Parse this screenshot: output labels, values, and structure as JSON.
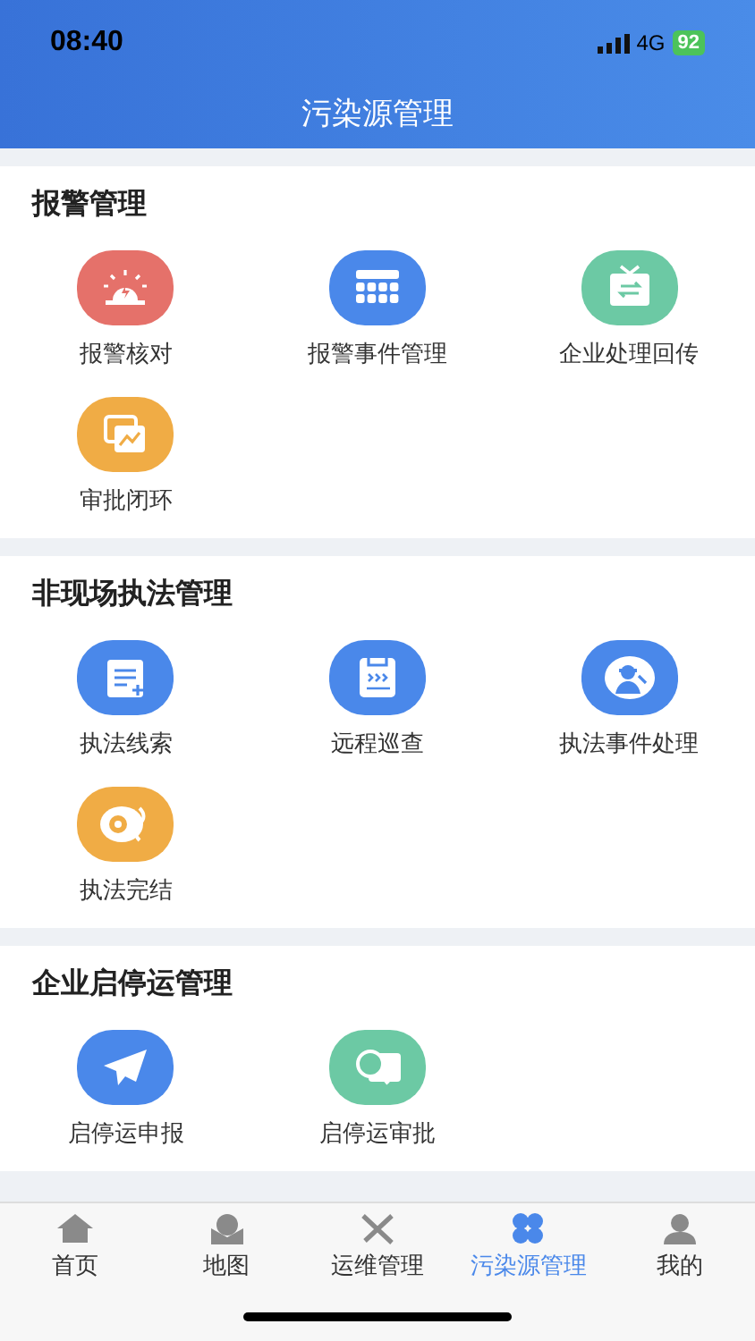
{
  "status_bar": {
    "time": "08:40",
    "network": "4G",
    "battery": "92"
  },
  "header": {
    "title": "污染源管理"
  },
  "sections": [
    {
      "title": "报警管理",
      "items": [
        {
          "label": "报警核对",
          "color": "#e5716a"
        },
        {
          "label": "报警事件管理",
          "color": "#4a88ea"
        },
        {
          "label": "企业处理回传",
          "color": "#6cc9a4"
        },
        {
          "label": "审批闭环",
          "color": "#f0ac45"
        }
      ]
    },
    {
      "title": "非现场执法管理",
      "items": [
        {
          "label": "执法线索",
          "color": "#4a88ea"
        },
        {
          "label": "远程巡查",
          "color": "#4a88ea"
        },
        {
          "label": "执法事件处理",
          "color": "#4a88ea"
        },
        {
          "label": "执法完结",
          "color": "#f0ac45"
        }
      ]
    },
    {
      "title": "企业启停运管理",
      "items": [
        {
          "label": "启停运申报",
          "color": "#4a88ea"
        },
        {
          "label": "启停运审批",
          "color": "#6cc9a4"
        }
      ]
    }
  ],
  "tab_bar": [
    {
      "label": "首页",
      "selected": false
    },
    {
      "label": "地图",
      "selected": false
    },
    {
      "label": "运维管理",
      "selected": false
    },
    {
      "label": "污染源管理",
      "selected": true
    },
    {
      "label": "我的",
      "selected": false
    }
  ]
}
